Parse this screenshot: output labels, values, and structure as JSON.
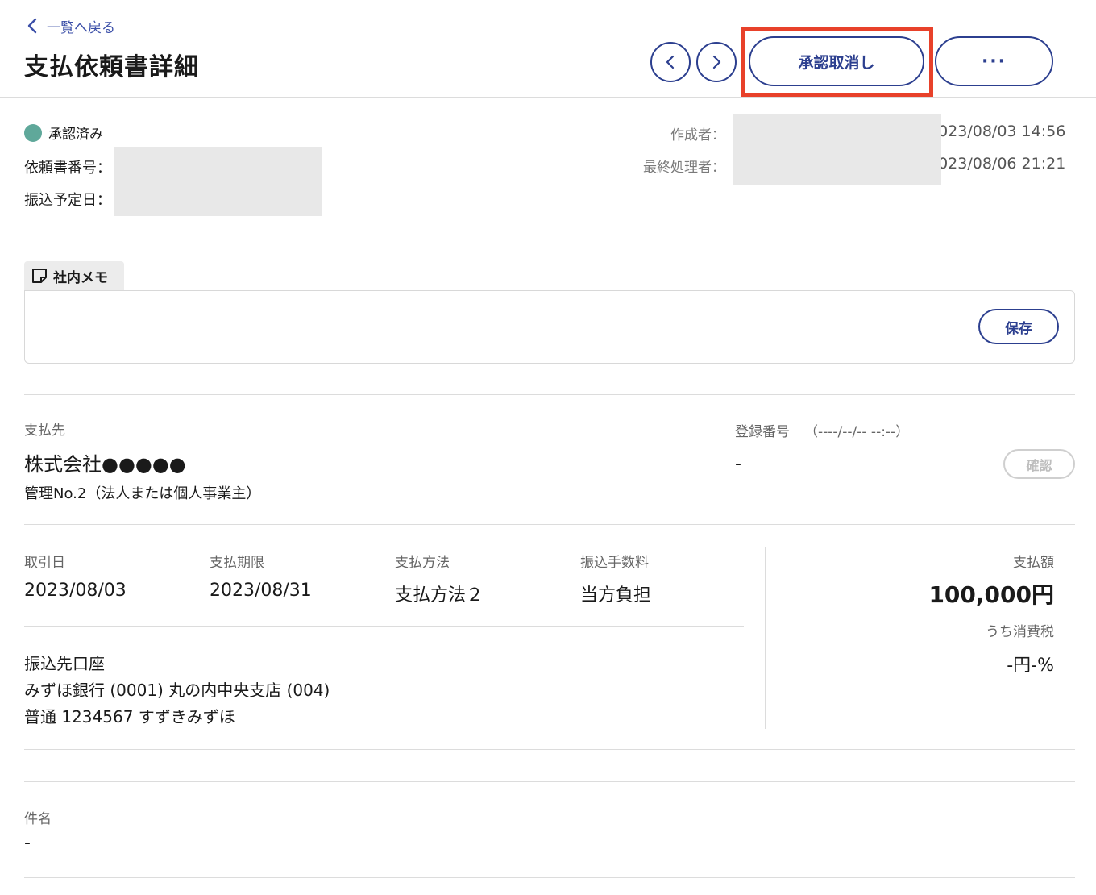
{
  "header": {
    "back_label": "一覧へ戻る",
    "title": "支払依頼書詳細",
    "cancel_approval_label": "承認取消し",
    "more_label": "···"
  },
  "status": {
    "label": "承認済み",
    "color": "#5fa89a"
  },
  "meta_left": {
    "request_no_label": "依頼書番号：",
    "transfer_date_label": "振込予定日："
  },
  "meta_right": {
    "creator_label": "作成者：",
    "creator_time": "2023/08/03 14:56",
    "last_processor_label": "最終処理者：",
    "last_processor_time": "2023/08/06 21:21"
  },
  "memo": {
    "tab_label": "社内メモ",
    "save_label": "保存"
  },
  "payee": {
    "label": "支払先",
    "name": "株式会社●●●●●",
    "sub": "管理No.2（法人または個人事業主）",
    "reg_label": "登録番号",
    "reg_date": "（----/--/-- --:--）",
    "reg_value": "-",
    "confirm_label": "確認"
  },
  "details": {
    "trade_date_label": "取引日",
    "trade_date": "2023/08/03",
    "due_label": "支払期限",
    "due": "2023/08/31",
    "method_label": "支払方法",
    "method": "支払方法２",
    "fee_label": "振込手数料",
    "fee": "当方負担",
    "account_label": "振込先口座",
    "account_bank": "みずほ銀行 (0001) 丸の内中央支店 (004)",
    "account_no": "普通 1234567 すずきみずほ"
  },
  "amount": {
    "label": "支払額",
    "value": "100,000円",
    "tax_label": "うち消費税",
    "tax_value": "-円-%"
  },
  "subject": {
    "label": "件名",
    "value": "-"
  },
  "colors": {
    "accent": "#2c3f8f",
    "highlight": "#e8412a"
  }
}
